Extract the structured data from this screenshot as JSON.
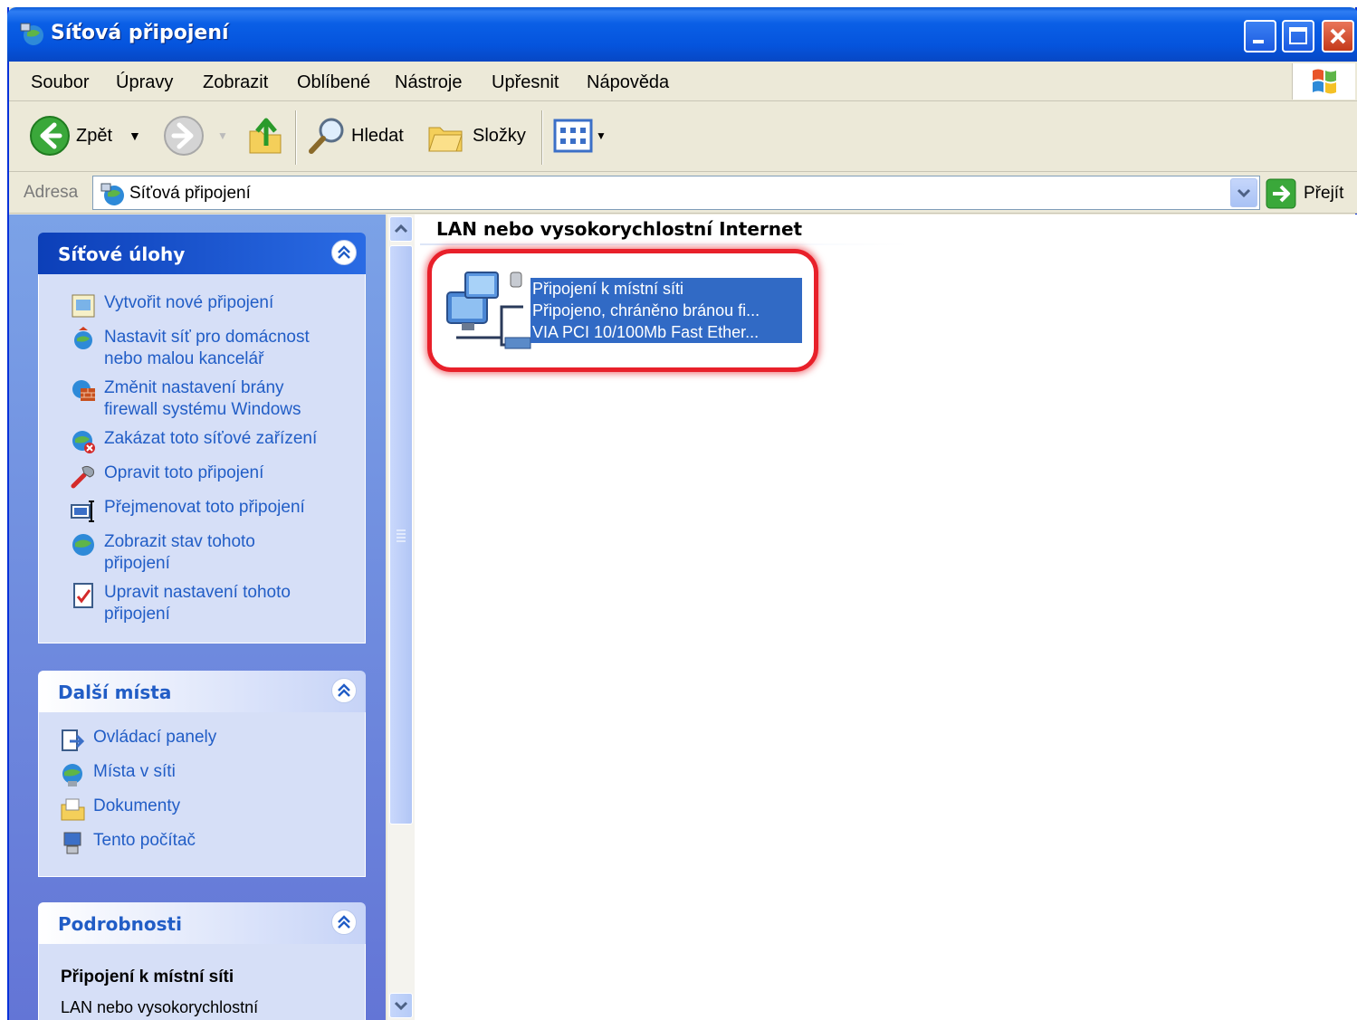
{
  "window": {
    "title": "Síťová připojení",
    "controls": [
      "minimize",
      "maximize",
      "close"
    ]
  },
  "menu": [
    "Soubor",
    "Úpravy",
    "Zobrazit",
    "Oblíbené",
    "Nástroje",
    "Upřesnit",
    "Nápověda"
  ],
  "toolbar": {
    "back_label": "Zpět",
    "search_label": "Hledat",
    "folders_label": "Složky"
  },
  "address": {
    "label": "Adresa",
    "value": "Síťová připojení",
    "go_label": "Přejít"
  },
  "tasks_panel": {
    "title": "Síťové úlohy",
    "items": [
      {
        "line1": "Vytvořit nové připojení",
        "line2": "",
        "icon": "new-connection-icon"
      },
      {
        "line1": "Nastavit síť pro domácnost",
        "line2": "nebo malou kancelář",
        "icon": "home-network-icon"
      },
      {
        "line1": "Změnit nastavení brány",
        "line2": "firewall systému Windows",
        "icon": "firewall-icon"
      },
      {
        "line1": "Zakázat toto síťové zařízení",
        "line2": "",
        "icon": "disable-device-icon"
      },
      {
        "line1": "Opravit toto připojení",
        "line2": "",
        "icon": "repair-icon"
      },
      {
        "line1": "Přejmenovat toto připojení",
        "line2": "",
        "icon": "rename-icon"
      },
      {
        "line1": "Zobrazit stav tohoto",
        "line2": "připojení",
        "icon": "status-icon"
      },
      {
        "line1": "Upravit nastavení tohoto",
        "line2": "připojení",
        "icon": "properties-icon"
      }
    ]
  },
  "places_panel": {
    "title": "Další místa",
    "items": [
      {
        "label": "Ovládací panely",
        "icon": "control-panel-icon"
      },
      {
        "label": "Místa v síti",
        "icon": "network-places-icon"
      },
      {
        "label": "Dokumenty",
        "icon": "documents-icon"
      },
      {
        "label": "Tento počítač",
        "icon": "my-computer-icon"
      }
    ]
  },
  "details_panel": {
    "title": "Podrobnosti",
    "name": "Připojení k místní síti",
    "type": "LAN nebo vysokorychlostní"
  },
  "content": {
    "group_title": "LAN nebo vysokorychlostní Internet",
    "connection": {
      "name": "Připojení k místní síti",
      "status": "Připojeno, chráněno bránou fi...",
      "device": "VIA PCI 10/100Mb Fast Ether...",
      "selected": true,
      "highlight_color": "#e8202a"
    }
  },
  "colors": {
    "title_bar": "#0554dd",
    "selection": "#316ac5",
    "task_link": "#215dc6",
    "left_pane": "#7ba2e7"
  }
}
